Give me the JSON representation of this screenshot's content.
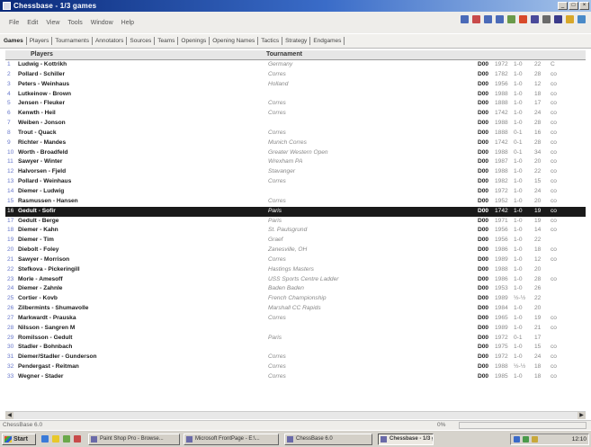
{
  "window": {
    "title": "Chessbase - 1/3 games",
    "min_glyph": "_",
    "max_glyph": "□",
    "close_glyph": "×"
  },
  "menu": [
    "File",
    "Edit",
    "View",
    "Tools",
    "Window",
    "Help"
  ],
  "toolbar": {
    "icons": [
      "back-icon",
      "forward-icon",
      "first-icon",
      "last-icon",
      "copy-icon",
      "delete-icon",
      "print-icon",
      "board-icon",
      "database-icon",
      "find-icon",
      "info-icon"
    ]
  },
  "tabs": [
    "Games",
    "Players",
    "Tournaments",
    "Annotators",
    "Sources",
    "Teams",
    "Openings",
    "Opening Names",
    "Tactics",
    "Strategy",
    "Endgames"
  ],
  "columns": {
    "players": "Players",
    "tournament": "Tournament"
  },
  "games": [
    {
      "n": "1",
      "players": "Ludwig - Kottrikh",
      "tournament": "Germany",
      "eco": "D00",
      "year": "1972",
      "result": "1-0",
      "moves": "22",
      "flag": "C"
    },
    {
      "n": "2",
      "players": "Pollard - Schiller",
      "tournament": "Corres",
      "eco": "D00",
      "year": "1782",
      "result": "1-0",
      "moves": "28",
      "flag": "co"
    },
    {
      "n": "3",
      "players": "Peters - Weinhaus",
      "tournament": "Holland",
      "eco": "D00",
      "year": "1956",
      "result": "1-0",
      "moves": "12",
      "flag": "co"
    },
    {
      "n": "4",
      "players": "Lutkeinow - Brown",
      "tournament": "",
      "eco": "D00",
      "year": "1988",
      "result": "1-0",
      "moves": "18",
      "flag": "co"
    },
    {
      "n": "5",
      "players": "Jensen - Fleuker",
      "tournament": "Corres",
      "eco": "D00",
      "year": "1888",
      "result": "1-0",
      "moves": "17",
      "flag": "co"
    },
    {
      "n": "6",
      "players": "Kenwth - Heil",
      "tournament": "Corres",
      "eco": "D00",
      "year": "1742",
      "result": "1-0",
      "moves": "24",
      "flag": "co"
    },
    {
      "n": "7",
      "players": "Weiben - Jonson",
      "tournament": "",
      "eco": "D00",
      "year": "1988",
      "result": "1-0",
      "moves": "28",
      "flag": "co"
    },
    {
      "n": "8",
      "players": "Trout - Quack",
      "tournament": "Corres",
      "eco": "D00",
      "year": "1888",
      "result": "0-1",
      "moves": "16",
      "flag": "co"
    },
    {
      "n": "9",
      "players": "Richter - Mandes",
      "tournament": "Munich Corres",
      "eco": "D00",
      "year": "1742",
      "result": "0-1",
      "moves": "28",
      "flag": "co"
    },
    {
      "n": "10",
      "players": "Worth - Broadfeld",
      "tournament": "Greater Western Open",
      "eco": "D00",
      "year": "1988",
      "result": "0-1",
      "moves": "34",
      "flag": "co"
    },
    {
      "n": "11",
      "players": "Sawyer - Winter",
      "tournament": "Wrexham PA",
      "eco": "D00",
      "year": "1987",
      "result": "1-0",
      "moves": "20",
      "flag": "co"
    },
    {
      "n": "12",
      "players": "Halvorsen - Fjeld",
      "tournament": "Stavanger",
      "eco": "D00",
      "year": "1988",
      "result": "1-0",
      "moves": "22",
      "flag": "co"
    },
    {
      "n": "13",
      "players": "Pollard - Weinhaus",
      "tournament": "Corres",
      "eco": "D00",
      "year": "1982",
      "result": "1-0",
      "moves": "15",
      "flag": "co"
    },
    {
      "n": "14",
      "players": "Diemer - Ludwig",
      "tournament": "",
      "eco": "D00",
      "year": "1972",
      "result": "1-0",
      "moves": "24",
      "flag": "co"
    },
    {
      "n": "15",
      "players": "Rasmussen - Hansen",
      "tournament": "Corres",
      "eco": "D00",
      "year": "1952",
      "result": "1-0",
      "moves": "20",
      "flag": "co"
    },
    {
      "n": "16",
      "players": "Gedult - Sofir",
      "tournament": "Paris",
      "eco": "D00",
      "year": "1742",
      "result": "1-0",
      "moves": "19",
      "flag": "co"
    },
    {
      "n": "17",
      "players": "Gedult - Berge",
      "tournament": "Paris",
      "eco": "D00",
      "year": "1971",
      "result": "1-0",
      "moves": "19",
      "flag": "co"
    },
    {
      "n": "18",
      "players": "Diemer - Kahn",
      "tournament": "St. Paulsgrund",
      "eco": "D00",
      "year": "1956",
      "result": "1-0",
      "moves": "14",
      "flag": "co"
    },
    {
      "n": "19",
      "players": "Diemer - Tim",
      "tournament": "Graef",
      "eco": "D00",
      "year": "1956",
      "result": "1-0",
      "moves": "22",
      "flag": ""
    },
    {
      "n": "20",
      "players": "Diebolt - Foley",
      "tournament": "Zanesville, OH",
      "eco": "D00",
      "year": "1986",
      "result": "1-0",
      "moves": "18",
      "flag": "co"
    },
    {
      "n": "21",
      "players": "Sawyer - Morrison",
      "tournament": "Corres",
      "eco": "D00",
      "year": "1989",
      "result": "1-0",
      "moves": "12",
      "flag": "co"
    },
    {
      "n": "22",
      "players": "Stefkova - Pickeringill",
      "tournament": "Hastings Masters",
      "eco": "D00",
      "year": "1988",
      "result": "1-0",
      "moves": "20",
      "flag": ""
    },
    {
      "n": "23",
      "players": "Morle - Amesoff",
      "tournament": "USS Sports Centre Ladder",
      "eco": "D00",
      "year": "1986",
      "result": "1-0",
      "moves": "28",
      "flag": "co"
    },
    {
      "n": "24",
      "players": "Diemer - Zahnle",
      "tournament": "Baden Baden",
      "eco": "D00",
      "year": "1953",
      "result": "1-0",
      "moves": "26",
      "flag": ""
    },
    {
      "n": "25",
      "players": "Cortier - Kovb",
      "tournament": "French Championship",
      "eco": "D00",
      "year": "1989",
      "result": "½-½",
      "moves": "22",
      "flag": ""
    },
    {
      "n": "26",
      "players": "Zilbermints - Shumavolle",
      "tournament": "Marshall CC Rapids",
      "eco": "D00",
      "year": "1984",
      "result": "1-0",
      "moves": "20",
      "flag": ""
    },
    {
      "n": "27",
      "players": "Markwardt - Prauska",
      "tournament": "Corres",
      "eco": "D00",
      "year": "1965",
      "result": "1-0",
      "moves": "19",
      "flag": "co"
    },
    {
      "n": "28",
      "players": "Nilsson - Sangren M",
      "tournament": "",
      "eco": "D00",
      "year": "1989",
      "result": "1-0",
      "moves": "21",
      "flag": "co"
    },
    {
      "n": "29",
      "players": "Romilsson - Gedult",
      "tournament": "Paris",
      "eco": "D00",
      "year": "1972",
      "result": "0-1",
      "moves": "17",
      "flag": ""
    },
    {
      "n": "30",
      "players": "Stadler - Bohnbach",
      "tournament": "",
      "eco": "D00",
      "year": "1975",
      "result": "1-0",
      "moves": "15",
      "flag": "co"
    },
    {
      "n": "31",
      "players": "Diemer/Stadler - Gunderson",
      "tournament": "Corres",
      "eco": "D00",
      "year": "1972",
      "result": "1-0",
      "moves": "24",
      "flag": "co"
    },
    {
      "n": "32",
      "players": "Pendergast - Reitman",
      "tournament": "Corres",
      "eco": "D00",
      "year": "1988",
      "result": "½-½",
      "moves": "18",
      "flag": "co"
    },
    {
      "n": "33",
      "players": "Wegner - Stader",
      "tournament": "Corres",
      "eco": "D00",
      "year": "1985",
      "result": "1-0",
      "moves": "18",
      "flag": "co"
    }
  ],
  "selected_row": 16,
  "statusbar": {
    "left": "ChessBase 6.0",
    "mid": "0%"
  },
  "taskbar": {
    "start": "Start",
    "tasks": [
      {
        "label": "Paint Shop Pro - Browse...",
        "active": false
      },
      {
        "label": "Microsoft FrontPage - E:\\...",
        "active": false
      },
      {
        "label": "ChessBase 6.0",
        "active": false
      },
      {
        "label": "Chessbase - 1/3 games",
        "active": true
      }
    ],
    "clock": "12:10"
  },
  "colors": {
    "title_bar": "#0a2a7a",
    "selected_row": "#1a1a1a",
    "row_number": "#6a7acc"
  }
}
